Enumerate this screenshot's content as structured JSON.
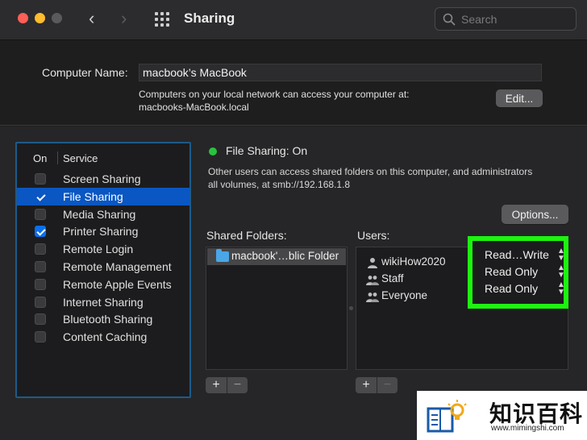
{
  "window": {
    "title": "Sharing",
    "search_placeholder": "Search"
  },
  "computer": {
    "label": "Computer Name:",
    "value": "macbook’s MacBook",
    "desc_line1": "Computers on your local network can access your computer at:",
    "desc_line2": "macbooks-MacBook.local",
    "edit_label": "Edit..."
  },
  "services": {
    "col_on": "On",
    "col_service": "Service",
    "items": [
      {
        "label": "Screen Sharing",
        "checked": false,
        "selected": false
      },
      {
        "label": "File Sharing",
        "checked": true,
        "selected": true
      },
      {
        "label": "Media Sharing",
        "checked": false,
        "selected": false
      },
      {
        "label": "Printer Sharing",
        "checked": true,
        "selected": false
      },
      {
        "label": "Remote Login",
        "checked": false,
        "selected": false
      },
      {
        "label": "Remote Management",
        "checked": false,
        "selected": false
      },
      {
        "label": "Remote Apple Events",
        "checked": false,
        "selected": false
      },
      {
        "label": "Internet Sharing",
        "checked": false,
        "selected": false
      },
      {
        "label": "Bluetooth Sharing",
        "checked": false,
        "selected": false
      },
      {
        "label": "Content Caching",
        "checked": false,
        "selected": false
      }
    ]
  },
  "detail": {
    "status": "File Sharing: On",
    "status_color": "#29c23e",
    "desc_line1": "Other users can access shared folders on this computer, and administrators",
    "desc_line2": "all volumes, at smb://192.168.1.8",
    "options_label": "Options...",
    "shared_folders_label": "Shared Folders:",
    "users_label": "Users:",
    "shared_folders": [
      "macbook'…blic Folder"
    ],
    "users": [
      {
        "name": "wikiHow2020",
        "icon": "person-icon",
        "permission": "Read…Write"
      },
      {
        "name": "Staff",
        "icon": "group-icon",
        "permission": "Read Only"
      },
      {
        "name": "Everyone",
        "icon": "group-icon",
        "permission": "Read Only"
      }
    ],
    "add_label": "+",
    "remove_label": "−"
  },
  "watermark": {
    "name": "知识百科",
    "url": "www.mimingshi.com"
  },
  "colors": {
    "highlight": "#1cf50f",
    "selection": "#0a56c2",
    "service_border": "#1d5a8a"
  }
}
